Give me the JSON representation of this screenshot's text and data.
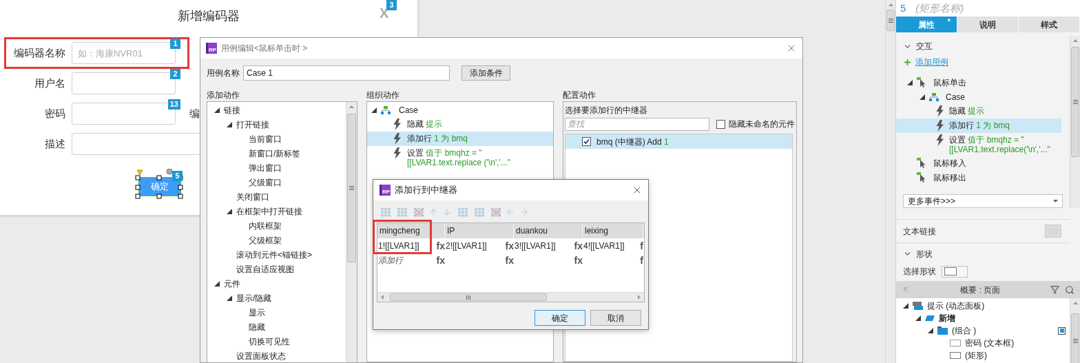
{
  "form": {
    "title": "新增编码器",
    "close": "X",
    "close_badge": "3",
    "fields": [
      {
        "label": "编码器名称",
        "placeholder": "如：海康NVR01",
        "badge": "1",
        "highlighted": true
      },
      {
        "label": "用户名",
        "badge": "2",
        "highlighted": false
      },
      {
        "label": "密码",
        "badge": "13",
        "side_label": "编",
        "highlighted": false
      },
      {
        "label": "描述",
        "highlighted": false
      }
    ],
    "submit": {
      "label": "确定",
      "badge": "5",
      "selected": true
    }
  },
  "case_editor": {
    "logo": "RP",
    "title": "用例编辑<鼠标单击时 >",
    "case_name_label": "用例名称",
    "case_name": "Case 1",
    "add_condition": "添加条件",
    "add_actions": {
      "heading": "添加动作",
      "tree": [
        {
          "label": "链接",
          "expanded": true,
          "children": [
            {
              "label": "打开链接",
              "expanded": true,
              "children": [
                {
                  "label": "当前窗口"
                },
                {
                  "label": "新窗口/新标签"
                },
                {
                  "label": "弹出窗口"
                },
                {
                  "label": "父级窗口"
                }
              ]
            },
            {
              "label": "关闭窗口"
            },
            {
              "label": "在框架中打开链接",
              "expanded": true,
              "children": [
                {
                  "label": "内联框架"
                },
                {
                  "label": "父级框架"
                }
              ]
            },
            {
              "label": "滚动到元件<锚链接>"
            },
            {
              "label": "设置自适应视图"
            }
          ]
        },
        {
          "label": "元件",
          "expanded": true,
          "children": [
            {
              "label": "显示/隐藏",
              "expanded": true,
              "children": [
                {
                  "label": "显示"
                },
                {
                  "label": "隐藏"
                },
                {
                  "label": "切换可见性"
                }
              ]
            },
            {
              "label": "设置面板状态"
            }
          ]
        }
      ]
    },
    "organize_actions": {
      "heading": "组织动作",
      "case": {
        "label": "Case",
        "expanded": true
      },
      "actions": [
        {
          "verb": "隐藏",
          "detail": "提示",
          "selected": false
        },
        {
          "verb": "添加行",
          "detail": "1 为 bmq",
          "selected": true
        },
        {
          "verb": "设置",
          "detail": "值于 bmqhz = \"[[LVAR1.text.replace ('\\n','...\"",
          "selected": false
        }
      ]
    },
    "configure_actions": {
      "heading": "配置动作",
      "prompt": "选择要添加行的中继器",
      "search_placeholder": "查找",
      "hide_unnamed": {
        "label": "隐藏未命名的元件",
        "checked": false
      },
      "repeaters": [
        {
          "name": "bmq (中继器) Add",
          "count": "1",
          "checked": true,
          "selected": true
        }
      ]
    }
  },
  "add_row_dialog": {
    "logo": "RP",
    "title": "添加行到中继器",
    "columns": [
      {
        "label": "mingcheng",
        "highlighted": true
      },
      {
        "label": "IP",
        "highlighted": false
      },
      {
        "label": "duankou",
        "highlighted": false
      },
      {
        "label": "leixing",
        "highlighted": false
      }
    ],
    "rows": [
      {
        "kind": "data",
        "cells": [
          {
            "value": "1![[LVAR1]]",
            "fx": "fx"
          },
          {
            "value": "2![[LVAR1]]",
            "fx": "fx"
          },
          {
            "value": "3![[LVAR1]]",
            "fx": "fx"
          },
          {
            "value": "4![[LVAR1]]",
            "fx": "f"
          }
        ]
      },
      {
        "kind": "add",
        "cells": [
          {
            "value": "添加行",
            "fx": "fx"
          },
          {
            "fx": "fx"
          },
          {
            "fx": "fx"
          },
          {
            "fx": "f"
          }
        ]
      }
    ],
    "buttons": [
      {
        "label": "确定",
        "primary": true
      },
      {
        "label": "取消",
        "primary": false
      }
    ]
  },
  "inspector": {
    "widget_number": "5",
    "widget_name": "(矩形名称)",
    "tabs": [
      {
        "label": "属性",
        "selected": true,
        "marker": "*"
      },
      {
        "label": "说明",
        "selected": false
      },
      {
        "label": "样式",
        "selected": false
      }
    ],
    "interactions": {
      "heading": "交互",
      "expanded": true,
      "add_case": "添加用例",
      "events": [
        {
          "label": "鼠标单击",
          "expanded": true,
          "cases": [
            {
              "label": "Case",
              "expanded": true,
              "actions": [
                {
                  "verb": "隐藏",
                  "detail": "提示",
                  "selected": false
                },
                {
                  "verb": "添加行",
                  "detail": "1 为 bmq",
                  "selected": true
                },
                {
                  "verb": "设置",
                  "detail": "值于 bmqhz = \"[[LVAR1.text.replace('\\n','...\"",
                  "selected": false
                }
              ]
            }
          ]
        },
        {
          "label": "鼠标移入"
        },
        {
          "label": "鼠标移出"
        }
      ],
      "more_events": "更多事件>>>"
    },
    "text_link": {
      "label": "文本链接"
    },
    "shape": {
      "heading": "形状",
      "expanded": true,
      "select_label": "选择形状"
    }
  },
  "outline": {
    "title": "概要 : 页面",
    "tree": [
      {
        "label": "提示 (动态面板)",
        "kind": "panel",
        "expanded": true,
        "marked": false,
        "children": [
          {
            "label": "新增",
            "kind": "state",
            "expanded": true,
            "marked": false,
            "children": [
              {
                "label": "(组合 )",
                "kind": "group",
                "expanded": true,
                "marked": true,
                "children": [
                  {
                    "label": "密码 (文本框)",
                    "kind": "textbox",
                    "marked": false
                  },
                  {
                    "label": "(矩形)",
                    "kind": "rect",
                    "marked": false
                  }
                ]
              }
            ]
          }
        ]
      }
    ]
  }
}
